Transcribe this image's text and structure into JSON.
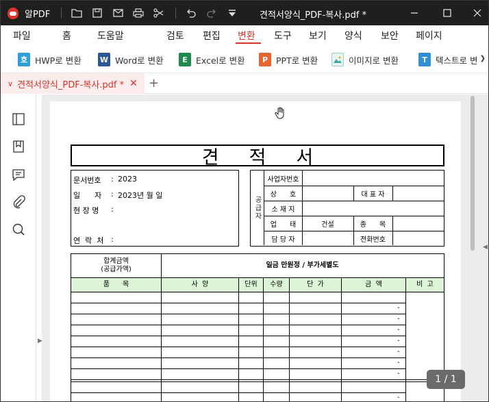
{
  "app": {
    "name": "알PDF",
    "window_title": "견적서양식_PDF-복사.pdf *"
  },
  "menu": [
    "파일",
    "홈",
    "도움말",
    "검토",
    "편집",
    "변환",
    "도구",
    "보기",
    "양식",
    "보안",
    "페이지"
  ],
  "menu_active": "변환",
  "ribbon": [
    {
      "label": "HWP로 변환",
      "icon": "hwp-icon",
      "icon_text": "호",
      "color": "#2e9fd8"
    },
    {
      "label": "Word로 변환",
      "icon": "word-icon",
      "icon_text": "W",
      "color": "#2b5797"
    },
    {
      "label": "Excel로 변환",
      "icon": "excel-icon",
      "icon_text": "E",
      "color": "#1f8a4c"
    },
    {
      "label": "PPT로 변환",
      "icon": "ppt-icon",
      "icon_text": "P",
      "color": "#e5662e"
    },
    {
      "label": "이미지로 변환",
      "icon": "image-icon",
      "icon_text": "",
      "color": "#3aa7a0"
    },
    {
      "label": "텍스트로 변",
      "icon": "text-icon",
      "icon_text": "T",
      "color": "#2e8fd8"
    }
  ],
  "tab": {
    "label": "견적서양식_PDF-복사.pdf *"
  },
  "form": {
    "title": "견적서",
    "info": {
      "doc_no_label": "문서번호",
      "doc_no_value": "2023",
      "date_label": "일      자",
      "date_value": "2023년 월 일",
      "site_label": "현 장 명",
      "contact_label": "연  락  처"
    },
    "supplier": {
      "side": "공급자",
      "biz_no": "사업자번호",
      "name": "상      호",
      "ceo": "대 표 자",
      "address": "소 재 지",
      "business": "업      태",
      "business_value": "건설",
      "item": "종      목",
      "manager": "담 당 자",
      "phone": "전화번호"
    },
    "total": {
      "label": "합계금액\n(공급가액)",
      "value": "일금 만원정 / 부가세별도"
    },
    "columns": [
      "품      목",
      "사  양",
      "단위",
      "수량",
      "단  가",
      "금  액",
      "비  고"
    ],
    "row_amount": "-"
  },
  "page_indicator": "1 / 1"
}
